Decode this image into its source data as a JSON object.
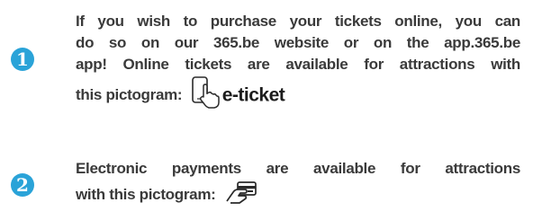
{
  "items": [
    {
      "number": "1",
      "lines": [
        "If you wish to purchase your tickets online, you can",
        "do so on our 365.be website or on the app.365.be",
        "app! Online tickets are available for attractions with",
        "this pictogram:"
      ],
      "pictogram": {
        "icon": "phone-tap-icon",
        "label": "e-ticket"
      }
    },
    {
      "number": "2",
      "lines": [
        "Electronic payments are available for attractions",
        "with this pictogram:"
      ],
      "pictogram": {
        "icon": "card-hand-icon"
      }
    }
  ],
  "colors": {
    "badge": "#2aa3d8",
    "text": "#3a3a3a"
  }
}
